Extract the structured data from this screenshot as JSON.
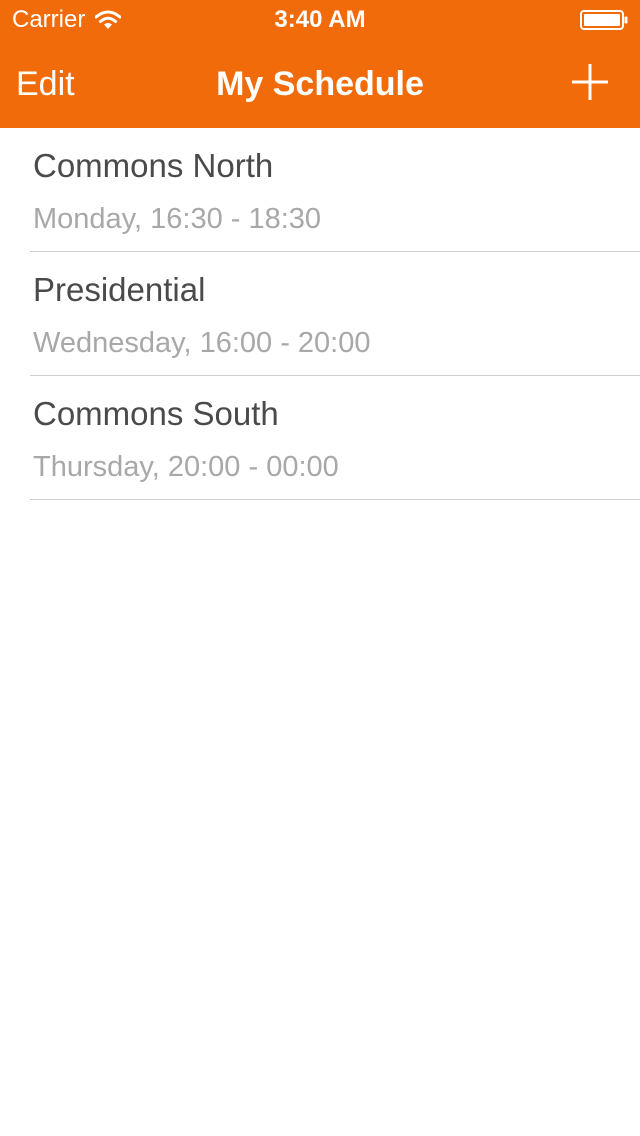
{
  "status_bar": {
    "carrier": "Carrier",
    "time": "3:40 AM",
    "wifi_icon": "wifi-icon",
    "battery_icon": "battery-icon"
  },
  "nav": {
    "edit_label": "Edit",
    "title": "My Schedule",
    "add_icon": "plus-icon"
  },
  "schedule": [
    {
      "name": "Commons North",
      "time": "Monday, 16:30 - 18:30"
    },
    {
      "name": "Presidential",
      "time": "Wednesday, 16:00 - 20:00"
    },
    {
      "name": "Commons South",
      "time": "Thursday, 20:00 - 00:00"
    }
  ],
  "colors": {
    "accent": "#f26b0a",
    "primary_text": "#4a4a4a",
    "secondary_text": "#a8a8a8",
    "separator": "#cfcfcf"
  }
}
